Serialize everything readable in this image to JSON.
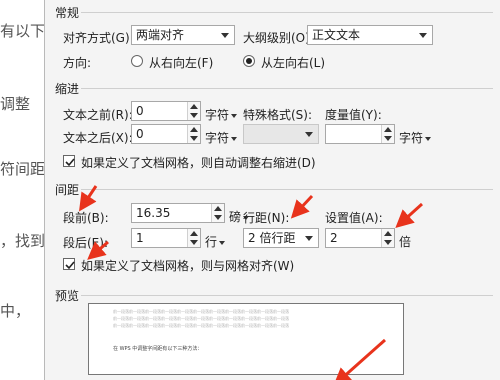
{
  "doc_lines": [
    "有以下",
    "调整",
    "符间距",
    "，找到",
    "中，",
    ""
  ],
  "general": {
    "title": "常规",
    "align_label": "对齐方式(G):",
    "align_value": "两端对齐",
    "outline_label": "大纲级别(O):",
    "outline_value": "正文文本",
    "direction_label": "方向:",
    "rtl_label": "从右向左(F)",
    "ltr_label": "从左向右(L)"
  },
  "indent": {
    "title": "缩进",
    "before_label": "文本之前(R):",
    "before_value": "0",
    "before_unit": "字符",
    "after_label": "文本之后(X):",
    "after_value": "0",
    "after_unit": "字符",
    "special_label": "特殊格式(S):",
    "special_value": "",
    "measure_label": "度量值(Y):",
    "measure_value": "",
    "measure_unit": "字符",
    "grid_check_label": "如果定义了文档网格，则自动调整右缩进(D)"
  },
  "spacing": {
    "title": "间距",
    "before_label": "段前(B):",
    "before_value": "16.35",
    "before_unit": "磅",
    "after_label": "段后(E):",
    "after_value": "1",
    "after_unit": "行",
    "line_label": "行距(N):",
    "line_value": "2 倍行距",
    "set_label": "设置值(A):",
    "set_value": "2",
    "set_unit": "倍",
    "grid_check_label": "如果定义了文档网格，则与网格对齐(W)"
  },
  "preview": {
    "title": "预览",
    "filler": "前一段落前一段落前一段落前一段落前一段落前一段落前一段落前一段落前一段落前一段落前一段落",
    "sample_text": "在 WPS 中调整字间距有以下三种方法："
  },
  "colors": {
    "annotation_arrow": "#e8331c",
    "dialog_bg": "#f4f4f4"
  }
}
